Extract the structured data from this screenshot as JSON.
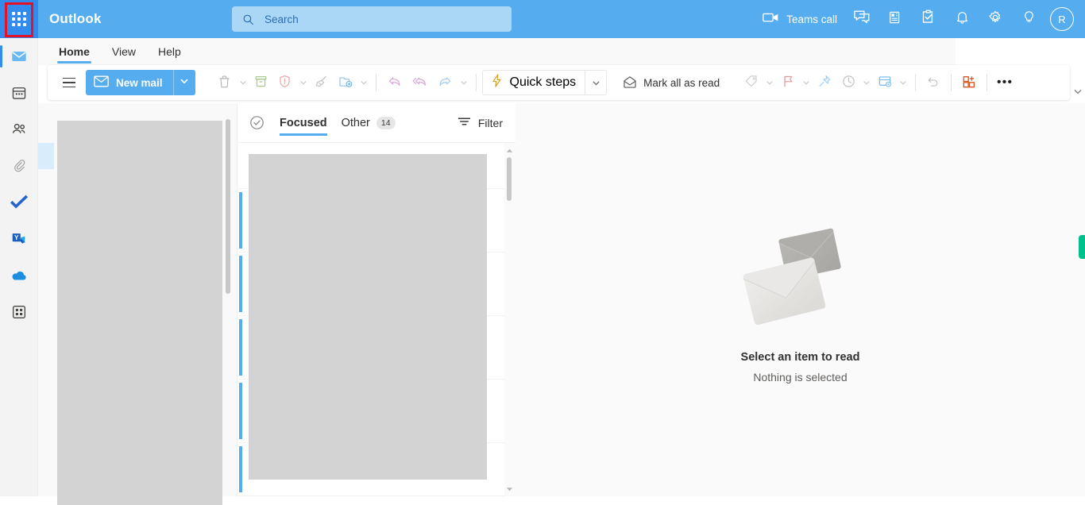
{
  "app": {
    "brand": "Outlook",
    "accent_color": "#55acee",
    "header_bg": "#55acee",
    "unread_bar_color": "#55acee",
    "annotation_color": "#e81123",
    "feedback_tab_color": "#00c08b"
  },
  "search": {
    "placeholder": "Search",
    "value": "",
    "icon": "search-icon"
  },
  "header_actions": [
    {
      "name": "teams-call",
      "icon": "video-camera-icon",
      "label": "Teams call"
    },
    {
      "name": "chat",
      "icon": "chat-bubble-icon",
      "label": ""
    },
    {
      "name": "meet-now",
      "icon": "meet-now-icon",
      "label": ""
    },
    {
      "name": "to-do",
      "icon": "checklist-icon",
      "label": ""
    },
    {
      "name": "notifications",
      "icon": "bell-icon",
      "label": ""
    },
    {
      "name": "settings",
      "icon": "gear-icon",
      "label": ""
    },
    {
      "name": "tips",
      "icon": "lightbulb-icon",
      "label": ""
    }
  ],
  "avatar": {
    "initial": "R"
  },
  "app_rail": {
    "waffle_icon": "app-launcher-waffle-icon",
    "items": [
      {
        "name": "mail",
        "icon": "mail-icon",
        "selected": true
      },
      {
        "name": "calendar",
        "icon": "calendar-icon",
        "selected": false
      },
      {
        "name": "people",
        "icon": "people-icon",
        "selected": false
      },
      {
        "name": "files",
        "icon": "paperclip-icon",
        "selected": false
      },
      {
        "name": "to-do",
        "icon": "checkmark-icon",
        "selected": false
      },
      {
        "name": "viva-engage",
        "icon": "yammer-icon",
        "selected": false
      },
      {
        "name": "onedrive",
        "icon": "cloud-icon",
        "selected": false
      },
      {
        "name": "all-apps",
        "icon": "grid-apps-icon",
        "selected": false
      }
    ]
  },
  "tabs": [
    {
      "label": "Home",
      "active": true
    },
    {
      "label": "View",
      "active": false
    },
    {
      "label": "Help",
      "active": false
    }
  ],
  "ribbon": {
    "hamburger": "hamburger-menu-icon",
    "new_mail": {
      "label": "New mail",
      "icon": "envelope-icon",
      "chevron": "chevron-down-icon"
    },
    "commands": [
      {
        "name": "delete",
        "icon": "trash-icon",
        "label": "",
        "chevron": true
      },
      {
        "name": "archive",
        "icon": "archive-icon",
        "label": "",
        "chevron": false
      },
      {
        "name": "report",
        "icon": "shield-alert-icon",
        "label": "",
        "chevron": true
      },
      {
        "name": "sweep",
        "icon": "broom-icon",
        "label": "",
        "chevron": false
      },
      {
        "name": "move-to",
        "icon": "move-folder-icon",
        "label": "",
        "chevron": true
      }
    ],
    "reply_group": [
      {
        "name": "reply",
        "icon": "reply-arrow-icon",
        "label": "",
        "chevron": false
      },
      {
        "name": "reply-all",
        "icon": "reply-all-arrow-icon",
        "label": "",
        "chevron": false
      },
      {
        "name": "forward",
        "icon": "forward-arrow-icon",
        "label": "",
        "chevron": true
      }
    ],
    "quick_steps": {
      "label": "Quick steps",
      "icon": "lightning-bolt-icon",
      "chevron": "chevron-down-icon"
    },
    "mark_all_read": {
      "label": "Mark all as read",
      "icon": "open-envelope-icon"
    },
    "tail_commands": [
      {
        "name": "categorize",
        "icon": "tag-icon",
        "label": "",
        "chevron": true
      },
      {
        "name": "flag",
        "icon": "flag-icon",
        "label": "",
        "chevron": true
      },
      {
        "name": "pin",
        "icon": "pin-icon",
        "label": "",
        "chevron": false
      },
      {
        "name": "snooze",
        "icon": "clock-icon",
        "label": "",
        "chevron": true
      },
      {
        "name": "rules",
        "icon": "rules-icon",
        "label": "",
        "chevron": true
      }
    ],
    "undo": {
      "name": "undo",
      "icon": "undo-arrow-icon"
    },
    "add_ins": {
      "name": "add-ins",
      "icon": "apps-add-icon"
    },
    "more": {
      "name": "more-commands",
      "icon": "ellipsis-icon",
      "label": "•••"
    },
    "collapse": {
      "name": "collapse-ribbon",
      "icon": "chevron-down-icon"
    }
  },
  "message_list": {
    "select_all_icon": "circle-check-icon",
    "pivots": [
      {
        "label": "Focused",
        "active": true,
        "count": ""
      },
      {
        "label": "Other",
        "active": false,
        "count": "14"
      }
    ],
    "filter": {
      "label": "Filter",
      "icon": "filter-icon"
    },
    "rows": [
      {
        "name": "message-row-1",
        "unread": true
      },
      {
        "name": "message-row-2",
        "unread": true
      },
      {
        "name": "message-row-3",
        "unread": true
      },
      {
        "name": "message-row-4",
        "unread": true
      },
      {
        "name": "message-row-5",
        "unread": true
      }
    ],
    "scrollbar": {
      "up_icon": "caret-up-icon",
      "down_icon": "caret-down-icon"
    }
  },
  "reading_pane": {
    "illustration": "two-envelopes-illustration",
    "title": "Select an item to read",
    "subtitle": "Nothing is selected"
  }
}
